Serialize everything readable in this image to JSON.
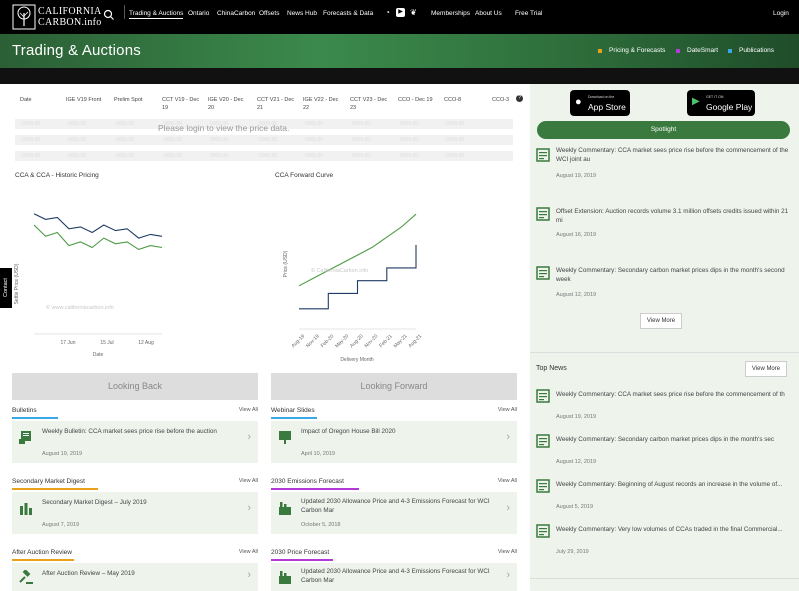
{
  "header": {
    "logo_text_line1": "CALIFORNIA",
    "logo_text_line2": "CARBON.info",
    "nav": [
      "Trading & Auctions",
      "Ontario",
      "ChinaCarbon",
      "Offsets",
      "News Hub",
      "Forecasts & Data"
    ],
    "nav_right": [
      "Memberships",
      "About Us",
      "Free Trial"
    ],
    "login": "Login"
  },
  "banner": {
    "title": "Trading & Auctions",
    "links": [
      {
        "label": "Pricing & Forecasts",
        "color": "#e8a21a"
      },
      {
        "label": "DateSmart",
        "color": "#b23ad6"
      },
      {
        "label": "Publications",
        "color": "#3aa8e8"
      }
    ]
  },
  "price_table": {
    "headers": [
      "Date",
      "IGE V19 Front",
      "Prelim Spot",
      "CCT V19 - Dec 19",
      "IGE V20 - Dec 20",
      "CCT V21 - Dec 21",
      "IGE V22 - Dec 22",
      "CCT V23 - Dec 23",
      "CCO - Dec 19",
      "CCO-8",
      "CCO-3"
    ],
    "placeholder_cell": "0000.00",
    "message": "Please login to view the price data.",
    "help": "?"
  },
  "charts": {
    "historic": {
      "title": "CCA & CCA - Historic Pricing",
      "ylabel": "Settle Price (USD)",
      "watermark": "© www.californiacarbon.info",
      "xticks": [
        "17 Jun",
        "15 Jul",
        "12 Aug"
      ],
      "xlabel": "Date",
      "button": "Looking Back"
    },
    "forward": {
      "title": "CCA Forward Curve",
      "ylabel": "Price (USD)",
      "watermark": "© CaliforniaCarbon.info",
      "xticks": [
        "Aug-19",
        "Nov-19",
        "Feb-20",
        "May-20",
        "Aug-20",
        "Nov-20",
        "Feb-21",
        "May-21",
        "Aug-21"
      ],
      "xlabel": "Delivery Month",
      "button": "Looking Forward"
    }
  },
  "sections": [
    {
      "title": "Bulletins",
      "color": "#3aa8e8",
      "view": "View All",
      "text": "Weekly Bulletin: CCA market sees price rise before the auction",
      "date": "August 19, 2019"
    },
    {
      "title": "Webinar Slides",
      "color": "#3aa8e8",
      "view": "View All",
      "text": "Impact of Oregon House Bill 2020",
      "date": "April 10, 2019"
    },
    {
      "title": "Secondary Market Digest",
      "color": "#e8a21a",
      "view": "View All",
      "text": "Secondary Market Digest – July 2019",
      "date": "August 7, 2019"
    },
    {
      "title": "2030 Emissions Forecast",
      "color": "#b23ad6",
      "view": "View All",
      "text": "Updated 2030 Allowance Price and 4-3 Emissions Forecast for WCI Carbon Mar",
      "date": "October 5, 2018"
    },
    {
      "title": "After Auction Review",
      "color": "#e8a21a",
      "view": "View All",
      "text": "After Auction Review – May 2019",
      "date": ""
    },
    {
      "title": "2030 Price Forecast",
      "color": "#b23ad6",
      "view": "View All",
      "text": "Updated 2030 Allowance Price and 4-3 Emissions Forecast for WCI Carbon Mar",
      "date": ""
    }
  ],
  "sidebar": {
    "appstore_small": "Download on the",
    "appstore": "App Store",
    "googleplay_small": "GET IT ON",
    "googleplay": "Google Play",
    "spotlight_label": "Spotlight",
    "spotlight": [
      {
        "text": "Weekly Commentary: CCA market sees price rise before the commencement of the WCI joint au",
        "date": "August 19, 2019"
      },
      {
        "text": "Offset Extension: Auction records volume 3.1 million offsets credits issued within 21 mi",
        "date": "August 16, 2019"
      },
      {
        "text": "Weekly Commentary: Secondary carbon market prices dips in the month's second week",
        "date": "August 12, 2019"
      }
    ],
    "view_more": "View More",
    "top_news_label": "Top News",
    "top_news": [
      {
        "text": "Weekly Commentary: CCA market sees price rise before the commencement of th",
        "date": "August 19, 2019"
      },
      {
        "text": "Weekly Commentary: Secondary carbon market prices dips in the month's sec",
        "date": "August 12, 2019"
      },
      {
        "text": "Weekly Commentary: Beginning of August records an increase in the volume of...",
        "date": "August 5, 2019"
      },
      {
        "text": "Weekly Commentary: Very low volumes of CCAs traded in the final Commercial...",
        "date": "July 29, 2019"
      }
    ]
  },
  "contact_tab": "Contact",
  "chart_data": [
    {
      "type": "line",
      "title": "CCA & CCA - Historic Pricing",
      "xlabel": "Date",
      "ylabel": "Settle Price (USD)",
      "x": [
        "17 Jun",
        "15 Jul",
        "12 Aug"
      ],
      "series": [
        {
          "values": [
            17.8,
            17.5,
            17.6,
            17.0,
            17.1,
            16.8,
            17.2,
            16.9,
            17.0,
            16.5,
            16.7,
            16.6
          ]
        },
        {
          "values": [
            17.2,
            16.6,
            16.8,
            16.1,
            16.3,
            16.0,
            16.5,
            16.2,
            16.3,
            15.9,
            16.1,
            16.0
          ]
        }
      ]
    },
    {
      "type": "line",
      "title": "CCA Forward Curve",
      "xlabel": "Delivery Month",
      "ylabel": "Price (USD)",
      "x": [
        "Aug-19",
        "Nov-19",
        "Feb-20",
        "May-20",
        "Aug-20",
        "Nov-20",
        "Feb-21",
        "May-21",
        "Aug-21"
      ],
      "series": [
        {
          "values": [
            17.3,
            17.6,
            17.9,
            18.2,
            18.5,
            18.8,
            19.2,
            19.6,
            20.1
          ]
        },
        {
          "values": [
            16.4,
            16.4,
            17.0,
            17.0,
            17.5,
            17.5,
            18.0,
            18.0,
            18.9
          ]
        }
      ]
    }
  ]
}
